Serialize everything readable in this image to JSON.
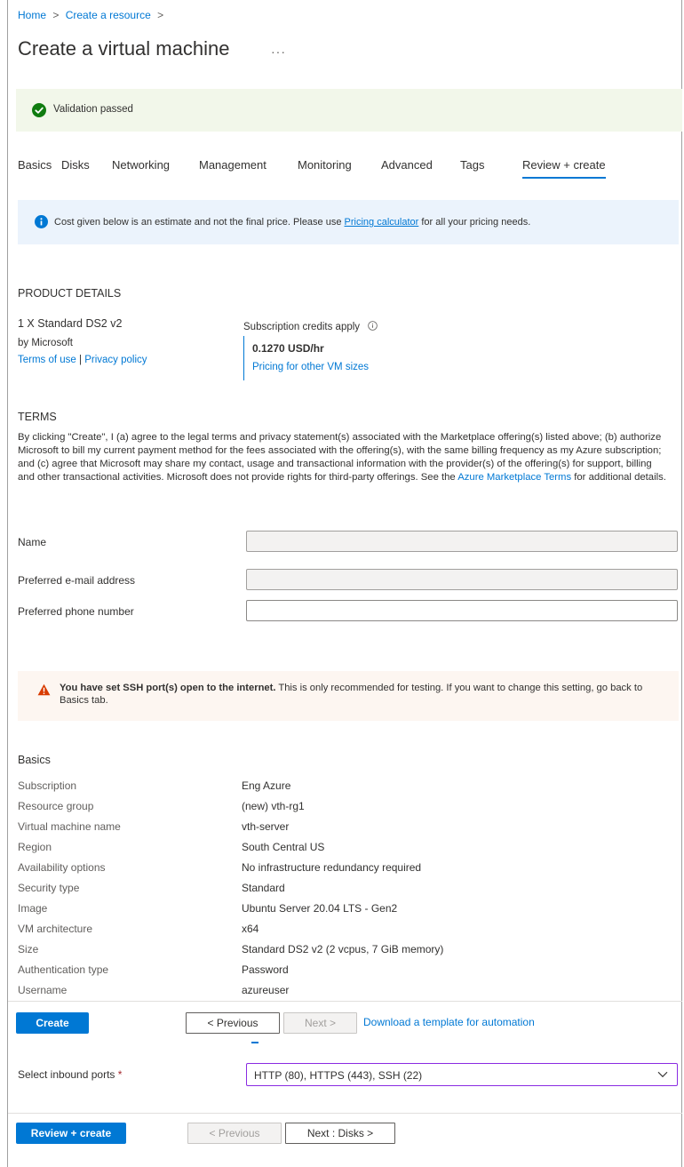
{
  "breadcrumb": {
    "home": "Home",
    "create_resource": "Create a resource",
    "sep": ">"
  },
  "page": {
    "title": "Create a virtual machine",
    "more": "···"
  },
  "validation": {
    "text": "Validation passed"
  },
  "tabs": [
    {
      "label": "Basics"
    },
    {
      "label": "Disks"
    },
    {
      "label": "Networking"
    },
    {
      "label": "Management"
    },
    {
      "label": "Monitoring"
    },
    {
      "label": "Advanced"
    },
    {
      "label": "Tags"
    },
    {
      "label": "Review + create",
      "active": true
    }
  ],
  "info_banner": {
    "text_before": "Cost given below is an estimate and not the final price. Please use",
    "link": "Pricing calculator",
    "text_after": "for all your pricing needs."
  },
  "product": {
    "heading": "PRODUCT DETAILS",
    "name": "1 X Standard DS2 v2",
    "publisher": "by Microsoft",
    "terms_link": "Terms of use",
    "link_sep": "|",
    "privacy_link": "Privacy policy",
    "credits": "Subscription credits apply",
    "price": "0.1270 USD/hr",
    "pricing_link": "Pricing for other VM sizes"
  },
  "terms": {
    "heading": "TERMS",
    "text_before": "By clicking \"Create\", I (a) agree to the legal terms and privacy statement(s) associated with the Marketplace offering(s) listed above; (b) authorize Microsoft to bill my current payment method for the fees associated with the offering(s), with the same billing frequency as my Azure subscription; and (c) agree that Microsoft may share my contact, usage and transactional information with the provider(s) of the offering(s) for support, billing and other transactional activities. Microsoft does not provide rights for third-party offerings. See the",
    "link": "Azure Marketplace Terms",
    "text_after": "for additional details."
  },
  "form": {
    "name_label": "Name",
    "name_value": "",
    "email_label": "Preferred e-mail address",
    "email_value": "",
    "phone_label": "Preferred phone number",
    "phone_value": ""
  },
  "warning": {
    "bold": "You have set SSH port(s) open to the internet.",
    "text": "This is only recommended for testing.  If you want to change this setting, go back to Basics tab."
  },
  "summary": {
    "heading": "Basics",
    "rows": [
      {
        "label": "Subscription",
        "value": "Eng Azure"
      },
      {
        "label": "Resource group",
        "value": "(new) vth-rg1"
      },
      {
        "label": "Virtual machine name",
        "value": "vth-server"
      },
      {
        "label": "Region",
        "value": "South Central US"
      },
      {
        "label": "Availability options",
        "value": "No infrastructure redundancy required"
      },
      {
        "label": "Security type",
        "value": "Standard"
      },
      {
        "label": "Image",
        "value": "Ubuntu Server 20.04 LTS - Gen2"
      },
      {
        "label": "VM architecture",
        "value": "x64"
      },
      {
        "label": "Size",
        "value": "Standard DS2 v2 (2 vcpus, 7 GiB memory)"
      },
      {
        "label": "Authentication type",
        "value": "Password"
      },
      {
        "label": "Username",
        "value": "azureuser"
      }
    ]
  },
  "footer1": {
    "create": "Create",
    "previous": "< Previous",
    "next": "Next >",
    "download": "Download a template for automation"
  },
  "ports": {
    "label": "Select inbound ports",
    "required": "*",
    "value": "HTTP (80), HTTPS (443), SSH (22)"
  },
  "footer2": {
    "review_create": "Review + create",
    "previous": "< Previous",
    "next": "Next : Disks >"
  },
  "colors": {
    "accent": "#0078d4",
    "success": "#107c10",
    "warning": "#d83b01",
    "required": "#a4262c"
  }
}
